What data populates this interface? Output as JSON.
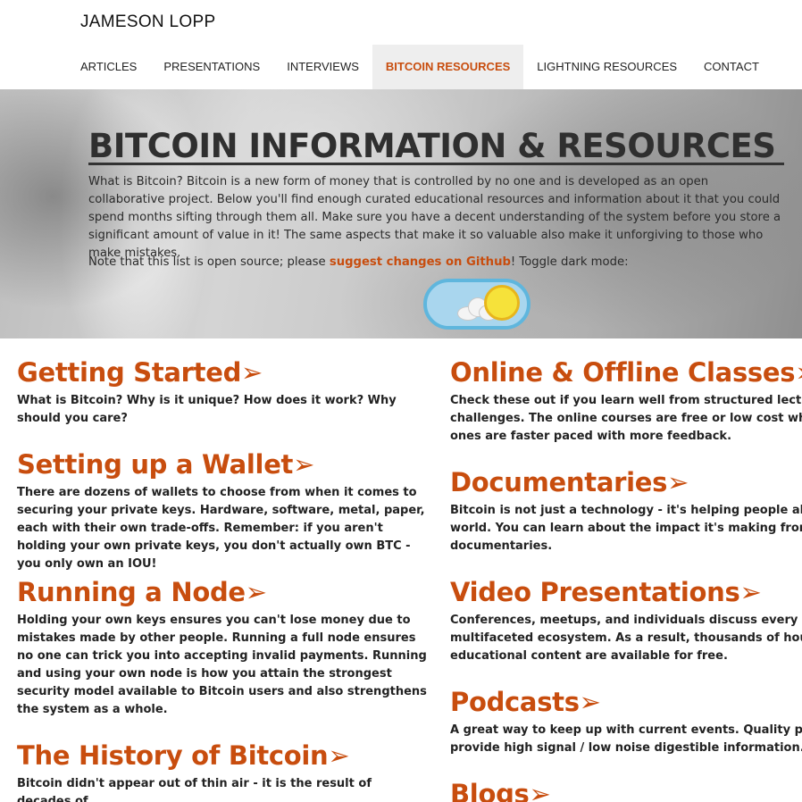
{
  "header": {
    "site_title": "JAMESON LOPP"
  },
  "nav": {
    "items": [
      {
        "label": "ARTICLES"
      },
      {
        "label": "PRESENTATIONS"
      },
      {
        "label": "INTERVIEWS"
      },
      {
        "label": "BITCOIN RESOURCES"
      },
      {
        "label": "LIGHTNING RESOURCES"
      },
      {
        "label": "CONTACT"
      }
    ],
    "active": "BITCOIN RESOURCES"
  },
  "hero": {
    "title": "BITCOIN INFORMATION & RESOURCES",
    "intro": "What is Bitcoin? Bitcoin is a new form of money that is controlled by no one and is developed as an open collaborative project. Below you'll find enough curated educational resources and information about it that you could spend months sifting through them all. Make sure you have a decent understanding of the system before you store a significant amount of value in it! The same aspects that make it so valuable also make it unforgiving to those who make mistakes.",
    "note_prefix": "Note that this list is open source; please ",
    "note_link": "suggest changes on Github",
    "note_suffix": "! Toggle dark mode:",
    "dark_mode_toggle_state": "light"
  },
  "sections_left": [
    {
      "title": "Getting Started➢",
      "desc": "What is Bitcoin? Why is it unique? How does it work? Why should you care?"
    },
    {
      "title": "Setting up a Wallet➢",
      "desc": "There are dozens of wallets to choose from when it comes to securing your private keys. Hardware, software, metal, paper, each with their own trade-offs. Remember: if you aren't holding your own private keys, you don't actually own BTC - you only own an IOU!"
    },
    {
      "title": "Running a Node➢",
      "desc": "Holding your own keys ensures you can't lose money due to mistakes made by other people. Running a full node ensures no one can trick you into accepting invalid payments. Running and using your own node is how you attain the strongest security model available to Bitcoin users and also strengthens the system as a whole."
    },
    {
      "title": "The History of Bitcoin➢",
      "desc": "Bitcoin didn't appear out of thin air - it is the result of decades of"
    }
  ],
  "sections_right": [
    {
      "title": "Online & Offline Classes➢",
      "desc_lines": [
        "Check these out if you learn well from structured lectures and",
        "challenges. The online courses are free or low cost while the",
        "ones are faster paced with more feedback."
      ]
    },
    {
      "title": "Documentaries➢",
      "desc_lines": [
        "Bitcoin is not just a technology - it's helping people all around",
        "world. You can learn about the impact it's making from a variety of",
        "documentaries."
      ]
    },
    {
      "title": "Video Presentations➢",
      "desc_lines": [
        "Conferences, meetups, and individuals discuss every aspect of",
        "multifaceted ecosystem. As a result, thousands of hours of",
        "educational content are available for free."
      ]
    },
    {
      "title": "Podcasts➢",
      "desc_lines": [
        "A great way to keep up with current events. Quality podcasts",
        "provide high signal / low noise digestible information."
      ]
    },
    {
      "title": "Blogs➢",
      "desc_lines": []
    }
  ],
  "colors": {
    "accent": "#c84d0e",
    "nav_active_bg": "#eeeeee",
    "toggle_bg": "#a9d6ee",
    "sun": "#f6e23a"
  }
}
